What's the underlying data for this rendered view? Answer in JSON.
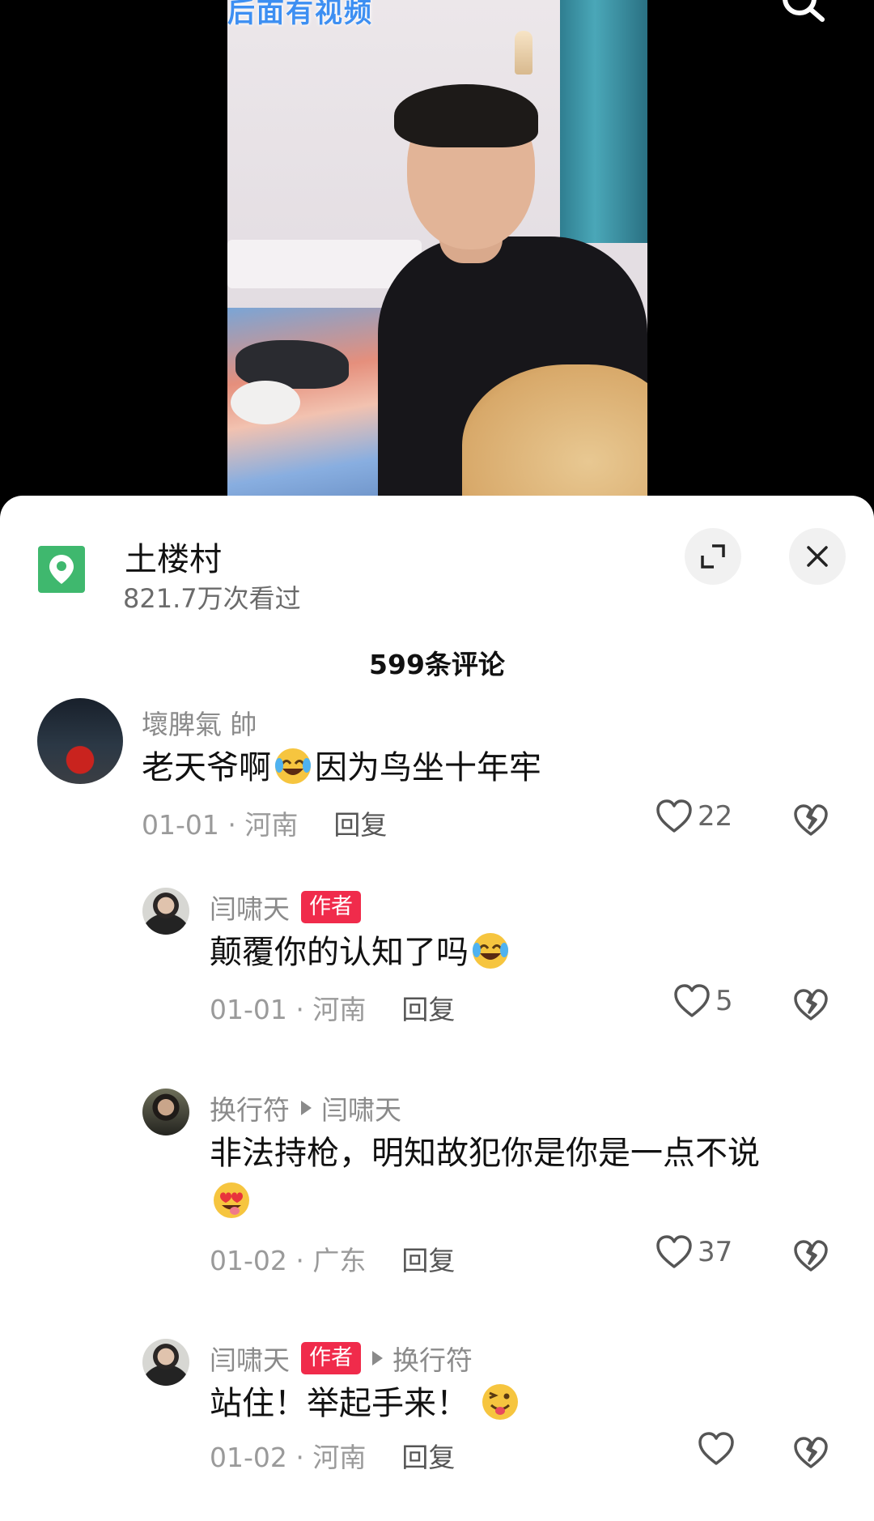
{
  "video": {
    "overlay_text": "后面有视频"
  },
  "header": {
    "location_name": "土楼村",
    "view_count": "821.7万次看过"
  },
  "comments_count": "599条评论",
  "comments": [
    {
      "user": "壞脾氣 帥",
      "text": "老天爷啊",
      "text_after": "因为鸟坐十年牢",
      "date": "01-01",
      "region": "河南",
      "reply_label": "回复",
      "likes": "22"
    },
    {
      "user": "闫啸天",
      "badge": "作者",
      "text": "颠覆你的认知了吗",
      "date": "01-01",
      "region": "河南",
      "reply_label": "回复",
      "likes": "5"
    },
    {
      "user": "换行符",
      "reply_to": "闫啸天",
      "text": "非法持枪，明知故犯你是你是一点不说",
      "date": "01-02",
      "region": "广东",
      "reply_label": "回复",
      "likes": "37"
    },
    {
      "user": "闫啸天",
      "badge": "作者",
      "reply_to": "换行符",
      "text": "站住！举起手来！",
      "date": "01-02",
      "region": "河南",
      "reply_label": "回复",
      "likes": ""
    }
  ],
  "icons": {
    "location": "location-pin-icon",
    "expand": "expand-icon",
    "close": "close-icon",
    "search": "search-icon",
    "like": "heart-outline-icon",
    "dislike": "broken-heart-icon"
  },
  "colors": {
    "badge": "#f02b4b",
    "location_icon": "#3fb86e",
    "overlay_text": "#3d8ff2"
  }
}
